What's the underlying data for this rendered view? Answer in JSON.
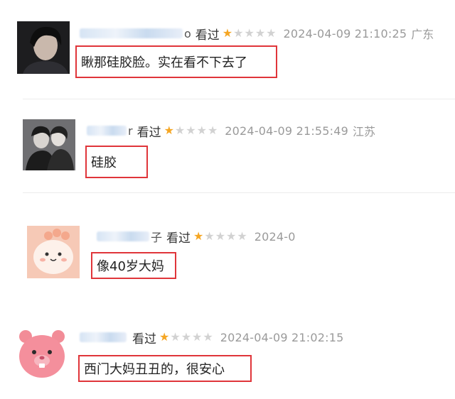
{
  "comments": [
    {
      "name_tail": "o",
      "status": "看过",
      "rating": 1,
      "timestamp": "2024-04-09 21:10:25",
      "location": "广东",
      "text": "瞅那硅胶脸。实在看不下去了"
    },
    {
      "name_tail": "r",
      "status": "看过",
      "rating": 1,
      "timestamp": "2024-04-09 21:55:49",
      "location": "江苏",
      "text": "硅胶"
    },
    {
      "name_tail": "子",
      "status": "看过",
      "rating": 1,
      "timestamp": "2024-0",
      "location": "",
      "text": "像40岁大妈"
    },
    {
      "name_tail": "",
      "status": "看过",
      "rating": 1,
      "timestamp": "2024-04-09 21:02:15",
      "location": "",
      "text": "西门大妈丑丑的，很安心"
    }
  ],
  "colors": {
    "star_on": "#f5a623",
    "star_off": "#d2d2d2",
    "highlight_border": "#e0353a",
    "meta_text": "#9a9a9a"
  }
}
